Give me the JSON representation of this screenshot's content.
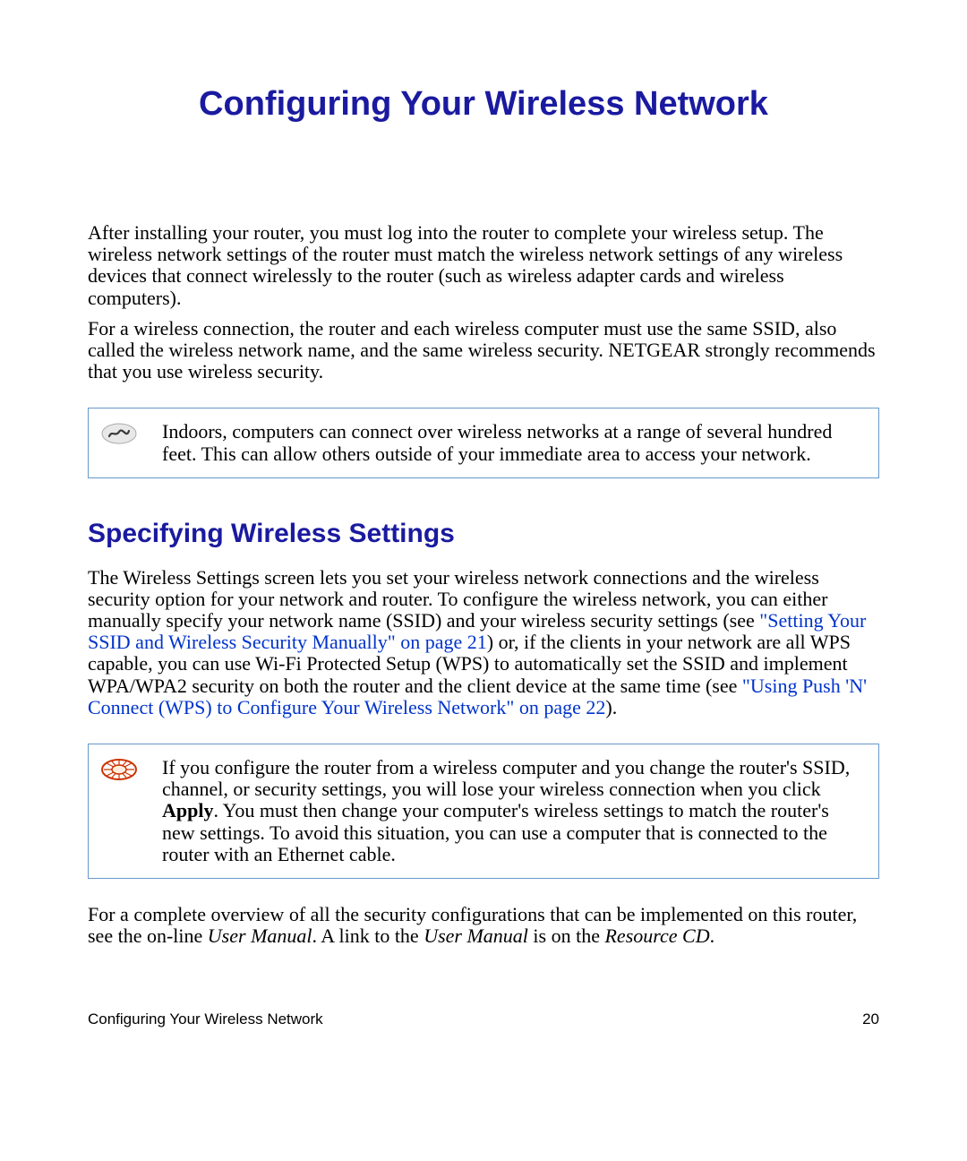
{
  "title": "Configuring Your Wireless Network",
  "para1": "After installing your router, you must log into the router to complete your wireless setup. The wireless network settings of the router must match the wireless network settings of any wireless devices that connect wirelessly to the router (such as wireless adapter cards and wireless computers).",
  "para2": "For a wireless connection, the router and each wireless computer must use the same SSID, also called the wireless network name, and the same wireless security. NETGEAR strongly recommends that you use wireless security.",
  "note1": "Indoors, computers can connect over wireless networks at a range of several hundred feet. This can allow others outside of your immediate area to access your network.",
  "heading2": "Specifying Wireless Settings",
  "p3_a": "The Wireless Settings screen lets you set your wireless network connections and the wireless security option for your network and router. To configure the wireless network, you can either manually specify your network name (SSID) and your wireless security settings (see ",
  "p3_link1": "\"Setting Your SSID and Wireless Security Manually\" on page 21",
  "p3_b": ") or, if the clients in your network are all WPS capable, you can use Wi-Fi Protected Setup (WPS) to automatically set the SSID and implement WPA/WPA2 security on both the router and the client device at the same time (see ",
  "p3_link2": "\"Using Push 'N' Connect (WPS) to Configure Your Wireless Network\" on page 22",
  "p3_c": ").",
  "note2_a": "If you configure the router from a wireless computer and you change the router's SSID, channel, or security settings, you will lose your wireless connection when you click ",
  "note2_bold": "Apply",
  "note2_b": ". You must then change your computer's wireless settings to match the router's new settings. To avoid this situation, you can use a computer that is connected to the router with an Ethernet cable.",
  "p4_a": "For a complete overview of all the security configurations that can be implemented on this router, see the on-line ",
  "p4_i1": "User Manual",
  "p4_b": ". A link to the ",
  "p4_i2": "User Manual",
  "p4_c": " is on the ",
  "p4_i3": "Resource CD",
  "p4_d": ".",
  "footer_left": "Configuring Your Wireless Network",
  "footer_right": "20"
}
